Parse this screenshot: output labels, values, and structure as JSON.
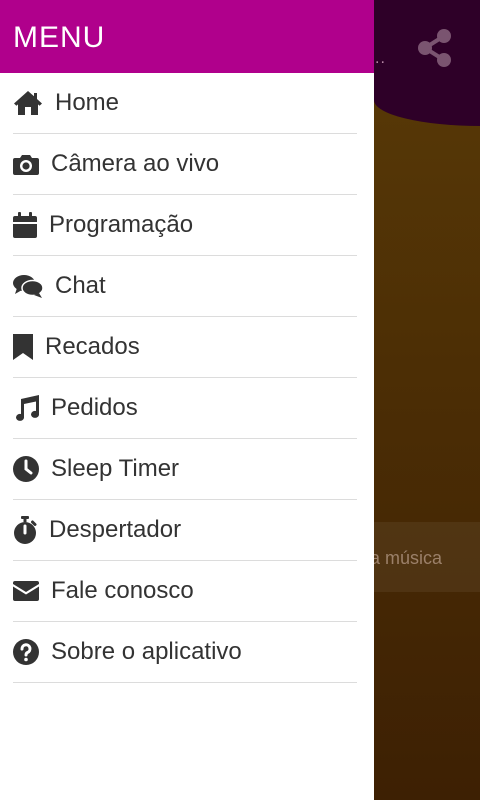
{
  "drawer": {
    "title": "MENU",
    "items": [
      {
        "label": "Home",
        "icon": "home-icon"
      },
      {
        "label": "Câmera ao vivo",
        "icon": "camera-icon"
      },
      {
        "label": "Programação",
        "icon": "calendar-icon"
      },
      {
        "label": "Chat",
        "icon": "chat-bubbles-icon"
      },
      {
        "label": "Recados",
        "icon": "bookmark-icon"
      },
      {
        "label": "Pedidos",
        "icon": "music-note-icon"
      },
      {
        "label": "Sleep Timer",
        "icon": "clock-icon"
      },
      {
        "label": "Despertador",
        "icon": "stopwatch-icon"
      },
      {
        "label": "Fale conosco",
        "icon": "envelope-icon"
      },
      {
        "label": "Sobre o aplicativo",
        "icon": "question-circle-icon"
      }
    ]
  },
  "background": {
    "strip_text": "a música",
    "dots": "..",
    "share_icon": "share-icon"
  },
  "colors": {
    "drawer_header": "#b0008c",
    "app_header": "#2e0028",
    "icon": "#333333"
  }
}
